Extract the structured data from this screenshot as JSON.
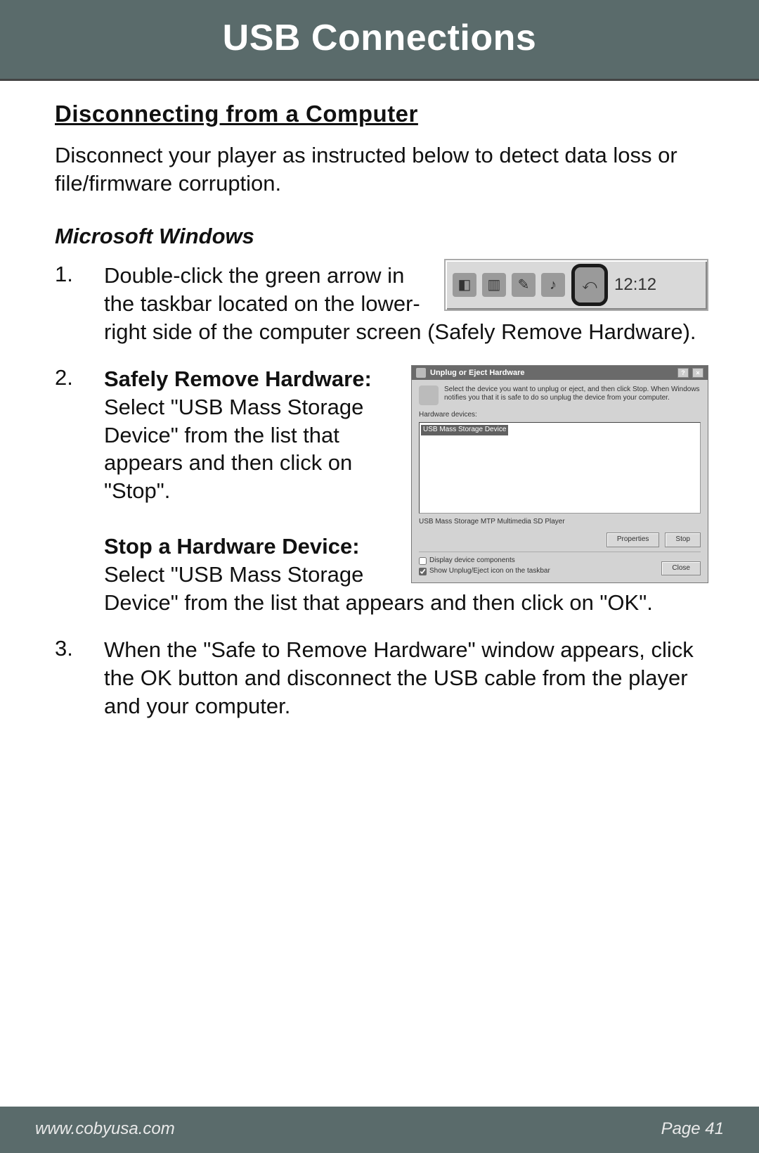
{
  "header": {
    "title": "USB Connections"
  },
  "section": {
    "title": "Disconnecting from a Computer",
    "intro": "Disconnect your player as instructed below to detect data loss or file/firmware corruption.",
    "subheading": "Microsoft Windows"
  },
  "steps": {
    "s1": {
      "num": "1.",
      "text": "Double-click the green arrow in the taskbar located on the lower-right side of the computer screen (Safely Remove Hardware)."
    },
    "s2": {
      "num": "2.",
      "h1": "Safely Remove Hardware: ",
      "t1": "Select \"USB Mass Storage Device\" from the list that appears and then click on \"Stop\".",
      "h2": "Stop a Hardware Device: ",
      "t2": "Select \"USB Mass Storage Device\" from the list that appears and then click on \"OK\"."
    },
    "s3": {
      "num": "3.",
      "text": "When the \"Safe to Remove Hardware\" window appears, click the OK button and disconnect the USB cable from the player and your computer."
    }
  },
  "taskbar": {
    "clock": "12:12"
  },
  "dialog": {
    "title": "Unplug or Eject Hardware",
    "desc": "Select the device you want to unplug or eject, and then click Stop. When Windows notifies you that it is safe to do so unplug the device from your computer.",
    "devices_label": "Hardware devices:",
    "list_item": "USB Mass Storage Device",
    "status": "USB Mass Storage MTP Multimedia SD Player",
    "btn_properties": "Properties",
    "btn_stop": "Stop",
    "chk1": "Display device components",
    "chk2": "Show Unplug/Eject icon on the taskbar",
    "btn_close": "Close"
  },
  "footer": {
    "url": "www.cobyusa.com",
    "page": "Page 41"
  }
}
